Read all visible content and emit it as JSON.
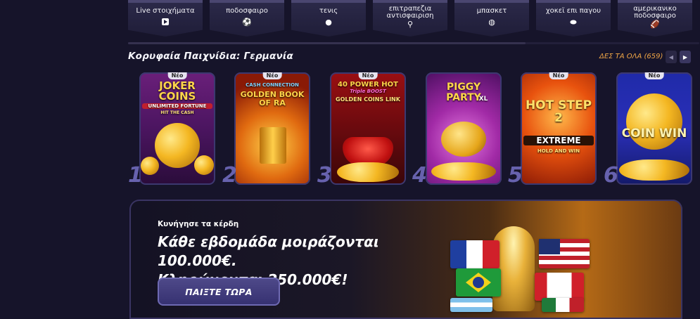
{
  "sports": [
    {
      "label": "Live στοιχήματα",
      "icon": "play-icon"
    },
    {
      "label": "ποδοσφαιρο",
      "icon": "soccer-ball-icon"
    },
    {
      "label": "τενις",
      "icon": "tennis-ball-icon"
    },
    {
      "label": "επιτραπεζια αντισφαιριση",
      "icon": "table-tennis-icon"
    },
    {
      "label": "μπασκετ",
      "icon": "basketball-icon"
    },
    {
      "label": "χοκεϊ επι παγου",
      "icon": "hockey-puck-icon"
    },
    {
      "label": "αμερικανικο ποδοσφαιρο",
      "icon": "american-football-icon"
    }
  ],
  "top_games": {
    "title": "Κορυφαία Παιχνίδια: Γερμανία",
    "see_all_label": "ΔΕΣ ΤΑ ΟΛΑ",
    "see_all_count": "(659)",
    "games": [
      {
        "rank": "1",
        "badge": "Νέο",
        "name": "JOKER COINS",
        "sub": "UNLIMITED FORTUNE",
        "sub2": "HIT THE CASH"
      },
      {
        "rank": "2",
        "badge": "Νέο",
        "name": "GOLDEN BOOK OF RA",
        "sub": "CASH CONNECTION",
        "sub2": ""
      },
      {
        "rank": "3",
        "badge": "Νέο",
        "name": "40 POWER HOT",
        "sub": "Triple BOOST",
        "sub2": "GOLDEN COINS LINK"
      },
      {
        "rank": "4",
        "badge": "",
        "name": "PIGGY PARTY",
        "sub": "XL",
        "sub2": ""
      },
      {
        "rank": "5",
        "badge": "Νέο",
        "name": "HOT STEP 2",
        "sub": "EXTREME",
        "sub2": "HOLD AND WIN"
      },
      {
        "rank": "6",
        "badge": "Νέο",
        "name": "COIN WIN",
        "sub": "",
        "sub2": ""
      }
    ]
  },
  "promo": {
    "kicker": "Κυνήγησε τα κέρδη",
    "line1": "Κάθε εβδομάδα μοιράζονται 100.000€.",
    "line2": "Κληρώνονται 250.000€!",
    "cta": "ΠΑΙΞΤΕ ΤΩΡΑ"
  },
  "colors": {
    "accent": "#f0a646",
    "rank": "#6c67b6",
    "bg": "#16142a"
  }
}
